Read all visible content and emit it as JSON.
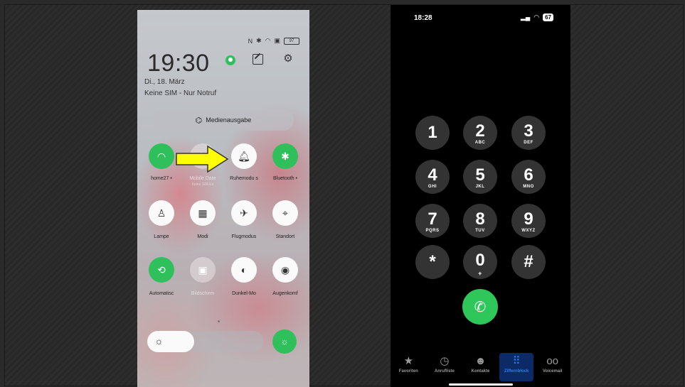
{
  "android": {
    "status_icons": [
      "nfc-icon",
      "bluetooth-icon",
      "wifi-icon",
      "sim-icon"
    ],
    "battery": "97",
    "time": "19:30",
    "date": "Di., 18. März",
    "sim_status": "Keine SIM - Nur Notruf",
    "media_output": "Medienausgabe",
    "tiles": [
      {
        "label": "home27 •",
        "sub": "",
        "icon": "wifi-icon",
        "state": "on"
      },
      {
        "label": "Mobile Date",
        "sub": "Keine SIM-Ka",
        "icon": "mobile-data-icon",
        "state": "disabled"
      },
      {
        "label": "Ruhemodu s",
        "sub": "",
        "icon": "bell-icon",
        "state": "off"
      },
      {
        "label": "Bluetooth •",
        "sub": "",
        "icon": "bluetooth-icon",
        "state": "on"
      },
      {
        "label": "Lampe",
        "sub": "",
        "icon": "flashlight-icon",
        "state": "off"
      },
      {
        "label": "Modi",
        "sub": "",
        "icon": "modes-icon",
        "state": "off"
      },
      {
        "label": "Flugmodus",
        "sub": "",
        "icon": "airplane-icon",
        "state": "off"
      },
      {
        "label": "Standort",
        "sub": "",
        "icon": "location-icon",
        "state": "off"
      },
      {
        "label": "Automatisc",
        "sub": "",
        "icon": "auto-rotate-icon",
        "state": "on"
      },
      {
        "label": "Bildschirm",
        "sub": "",
        "icon": "screen-record-icon",
        "state": "disabled"
      },
      {
        "label": "Dunkel-Mo",
        "sub": "",
        "icon": "dark-mode-icon",
        "state": "off"
      },
      {
        "label": "Augenkomf",
        "sub": "",
        "icon": "eye-comfort-icon",
        "state": "off"
      }
    ],
    "brightness_level_pct": 40,
    "colors": {
      "accent_green": "#2fbf5b",
      "arrow_yellow": "#ffff00"
    }
  },
  "ios": {
    "time": "18:28",
    "battery": "67",
    "keys": [
      {
        "digit": "1",
        "letters": ""
      },
      {
        "digit": "2",
        "letters": "ABC"
      },
      {
        "digit": "3",
        "letters": "DEF"
      },
      {
        "digit": "4",
        "letters": "GHI"
      },
      {
        "digit": "5",
        "letters": "JKL"
      },
      {
        "digit": "6",
        "letters": "MNO"
      },
      {
        "digit": "7",
        "letters": "PQRS"
      },
      {
        "digit": "8",
        "letters": "TUV"
      },
      {
        "digit": "9",
        "letters": "WXYZ"
      },
      {
        "digit": "*",
        "letters": ""
      },
      {
        "digit": "0",
        "letters": "+"
      },
      {
        "digit": "#",
        "letters": ""
      }
    ],
    "tabs": [
      {
        "label": "Favoriten",
        "icon": "star-icon"
      },
      {
        "label": "Anrufliste",
        "icon": "clock-icon"
      },
      {
        "label": "Kontakte",
        "icon": "person-icon"
      },
      {
        "label": "Ziffernblock",
        "icon": "keypad-icon",
        "active": true
      },
      {
        "label": "Voicemail",
        "icon": "voicemail-icon"
      }
    ],
    "colors": {
      "call_green": "#2fc759",
      "active_tab": "#2d7cf6"
    }
  }
}
